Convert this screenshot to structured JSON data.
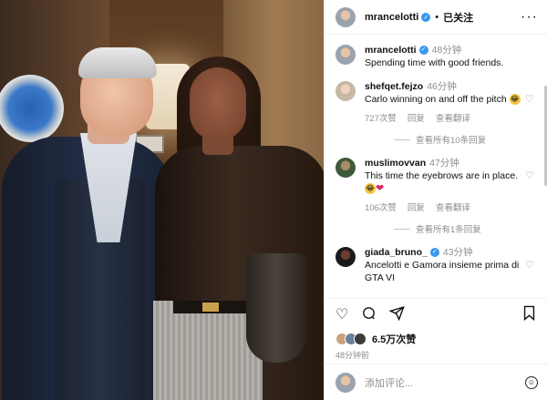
{
  "post": {
    "username": "mrancelotti",
    "follow_label": "已关注",
    "more_label": "···",
    "caption": {
      "username": "mrancelotti",
      "time": "48分钟",
      "text": "Spending time with good friends."
    },
    "comments": [
      {
        "username": "shefqet.fejzo",
        "time": "46分钟",
        "text": "Carlo winning on and off the pitch",
        "likes": "727次赞",
        "reply": "回复",
        "translate": "查看翻译",
        "view_replies": "查看所有10条回复",
        "emoji": "laugh"
      },
      {
        "username": "muslimovvan",
        "time": "47分钟",
        "text": "This time the eyebrows are in place.",
        "likes": "106次赞",
        "reply": "回复",
        "translate": "查看翻译",
        "view_replies": "查看所有1条回复",
        "emoji": "laugh-heart"
      },
      {
        "username": "giada_bruno_",
        "time": "43分钟",
        "text": "Ancelotti e Gamora insieme prima di GTA VI"
      }
    ],
    "likes_count": "6.5万次赞",
    "posted_ago": "48分钟前",
    "add_comment_placeholder": "添加评论..."
  },
  "icons": {
    "like": "heart-outline-icon",
    "comment": "comment-bubble-icon",
    "share": "paper-plane-icon",
    "save": "bookmark-icon",
    "verified": "verified-badge-icon",
    "emoji": "smiley-icon"
  },
  "colors": {
    "verified_blue": "#3897f0",
    "muted_text": "#8e8e8e",
    "heart_red": "#e0245e"
  }
}
